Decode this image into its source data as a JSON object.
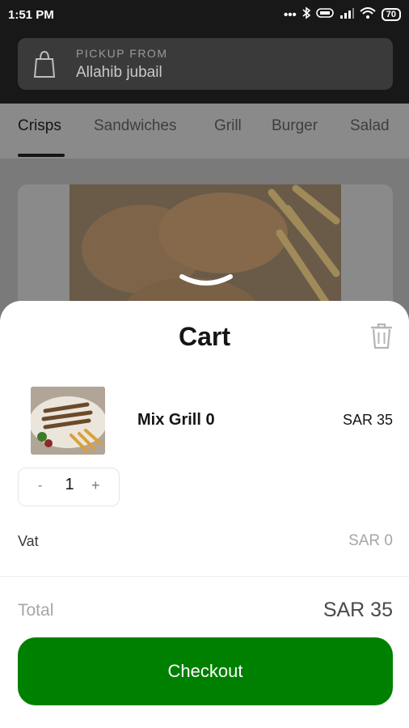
{
  "status_bar": {
    "time": "1:51 PM",
    "battery": "70"
  },
  "pickup": {
    "label": "PICKUP FROM",
    "location": "Allahib jubail"
  },
  "tabs": [
    "Crisps",
    "Sandwiches",
    "Grill",
    "Burger",
    "Salad"
  ],
  "active_tab": "Crisps",
  "cart": {
    "title": "Cart",
    "items": [
      {
        "name": "Mix Grill 0",
        "price": "SAR 35",
        "quantity": "1"
      }
    ],
    "stepper": {
      "minus": "-",
      "plus": "+"
    },
    "vat_label": "Vat",
    "vat_value": "SAR 0",
    "total_label": "Total",
    "total_value": "SAR 35",
    "checkout_label": "Checkout"
  },
  "colors": {
    "accent": "#008000",
    "overlay": "#7a7a7a",
    "header": "#181818"
  }
}
